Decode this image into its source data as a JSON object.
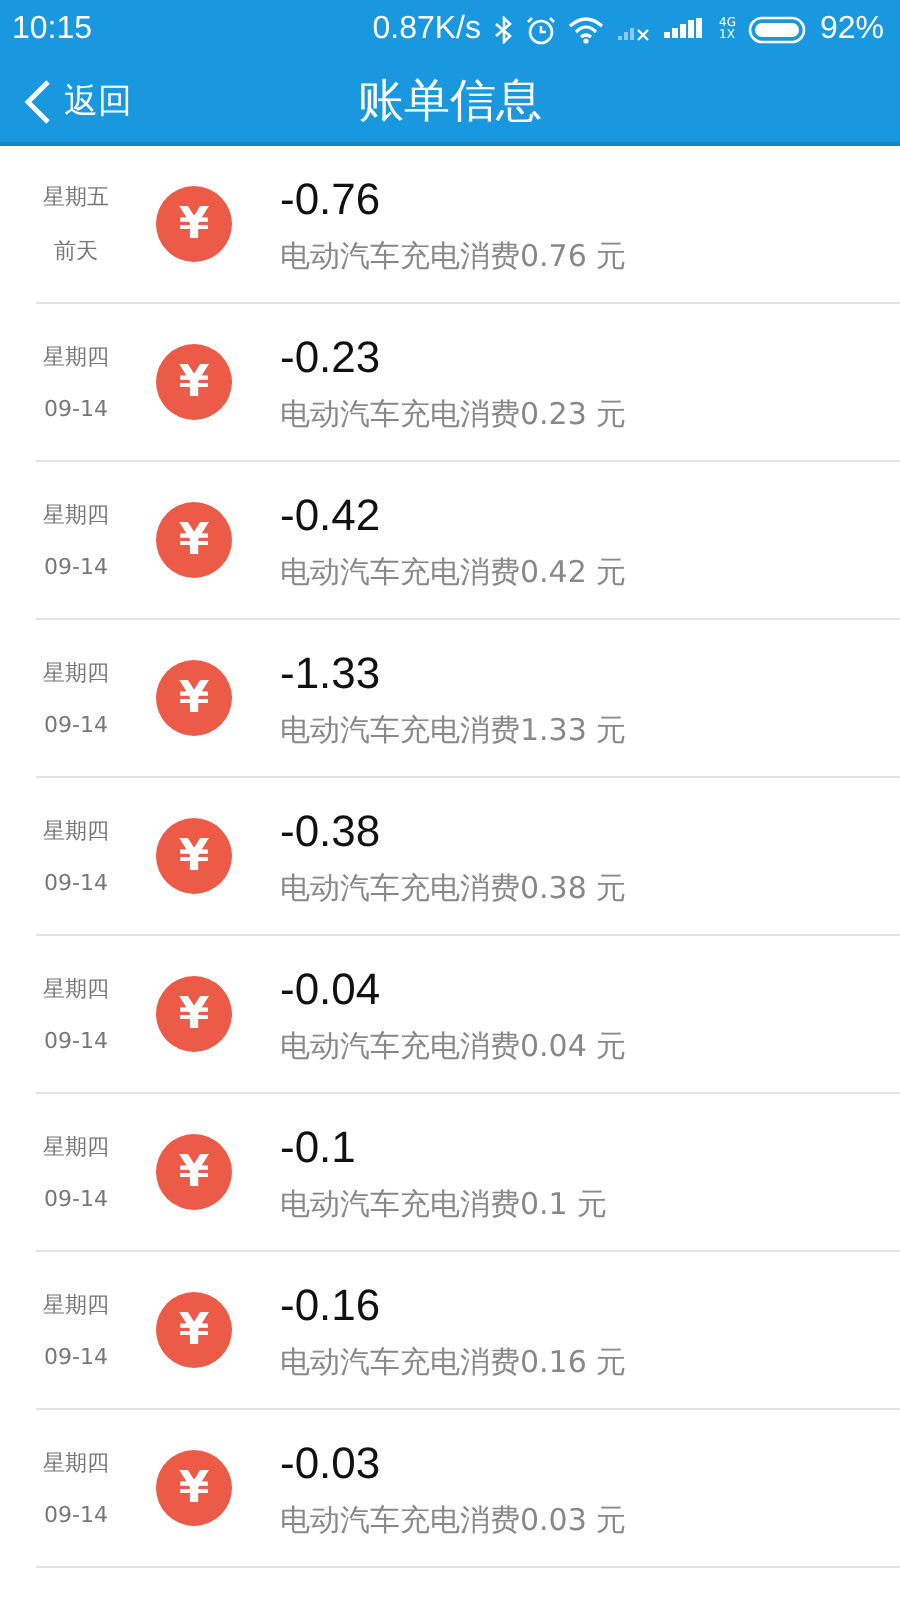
{
  "status_bar": {
    "time": "10:15",
    "speed": "0.87K/s",
    "network": "4G\n1X",
    "battery": "92%"
  },
  "nav": {
    "back": "返回",
    "title": "账单信息"
  },
  "bills": [
    {
      "weekday": "星期五",
      "date": "前天",
      "symbol": "¥",
      "amount": "-0.76",
      "desc": "电动汽车充电消费0.76 元"
    },
    {
      "weekday": "星期四",
      "date": "09-14",
      "symbol": "¥",
      "amount": "-0.23",
      "desc": "电动汽车充电消费0.23 元"
    },
    {
      "weekday": "星期四",
      "date": "09-14",
      "symbol": "¥",
      "amount": "-0.42",
      "desc": "电动汽车充电消费0.42 元"
    },
    {
      "weekday": "星期四",
      "date": "09-14",
      "symbol": "¥",
      "amount": "-1.33",
      "desc": "电动汽车充电消费1.33 元"
    },
    {
      "weekday": "星期四",
      "date": "09-14",
      "symbol": "¥",
      "amount": "-0.38",
      "desc": "电动汽车充电消费0.38 元"
    },
    {
      "weekday": "星期四",
      "date": "09-14",
      "symbol": "¥",
      "amount": "-0.04",
      "desc": "电动汽车充电消费0.04 元"
    },
    {
      "weekday": "星期四",
      "date": "09-14",
      "symbol": "¥",
      "amount": "-0.1",
      "desc": "电动汽车充电消费0.1 元"
    },
    {
      "weekday": "星期四",
      "date": "09-14",
      "symbol": "¥",
      "amount": "-0.16",
      "desc": "电动汽车充电消费0.16 元"
    },
    {
      "weekday": "星期四",
      "date": "09-14",
      "symbol": "¥",
      "amount": "-0.03",
      "desc": "电动汽车充电消费0.03 元"
    }
  ]
}
